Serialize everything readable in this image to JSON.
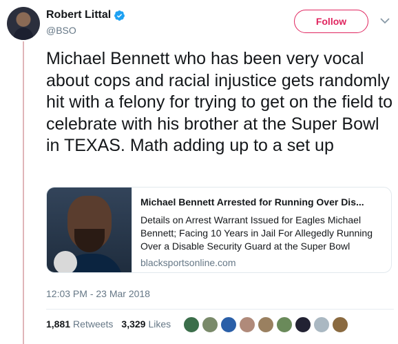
{
  "author": {
    "display_name": "Robert Littal",
    "handle": "@BSO",
    "verified": true
  },
  "follow_button": {
    "label": "Follow",
    "color": "#e0245e"
  },
  "tweet": {
    "text": "Michael Bennett who has been very vocal about cops and racial injustice gets randomly hit with a felony for trying to get on the field to celebrate with his brother at the Super Bowl in TEXAS. Math adding up to a set up"
  },
  "card": {
    "title": "Michael Bennett Arrested for Running Over Dis...",
    "description": "Details on Arrest Warrant Issued for Eagles Michael Bennett; Facing 10 Years in Jail For Allegedly Running Over a Disable Security Guard at the Super Bowl",
    "domain": "blacksportsonline.com"
  },
  "timestamp": "12:03 PM - 23 Mar 2018",
  "stats": {
    "retweets_count": "1,881",
    "retweets_label": "Retweets",
    "likes_count": "3,329",
    "likes_label": "Likes"
  },
  "likers": [
    {
      "color": "#3b6e4a"
    },
    {
      "color": "#7a8a6a"
    },
    {
      "color": "#2a5fa8"
    },
    {
      "color": "#b08a7a"
    },
    {
      "color": "#9a8060"
    },
    {
      "color": "#6a8a5a"
    },
    {
      "color": "#222233"
    },
    {
      "color": "#aab8c2"
    },
    {
      "color": "#8a6a40"
    }
  ],
  "colors": {
    "thread_line": "#e0b5b8",
    "verified_badge": "#1da1f2",
    "secondary_text": "#657786"
  }
}
